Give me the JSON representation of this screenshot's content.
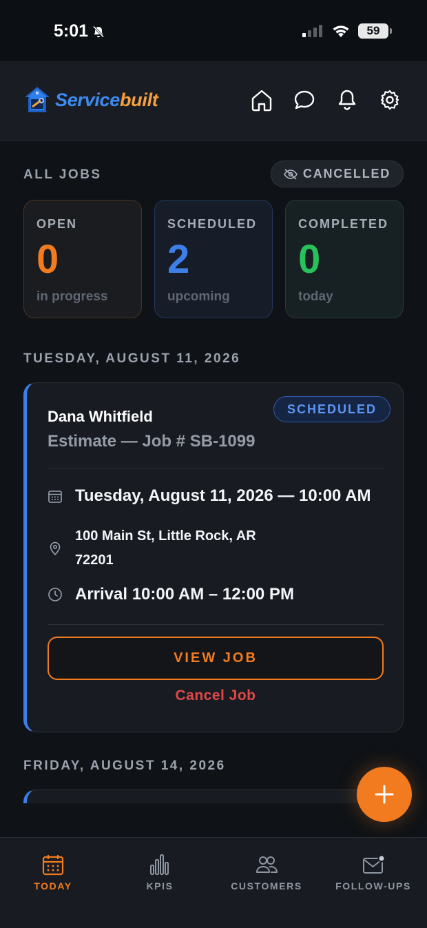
{
  "status_bar": {
    "time": "5:01",
    "battery": "59"
  },
  "header": {
    "brand_part1": "Service",
    "brand_part2": "built",
    "icons": [
      "home-icon",
      "chat-icon",
      "bell-icon",
      "gear-icon"
    ]
  },
  "summary": {
    "section_label": "ALL JOBS",
    "cancelled_toggle": "CANCELLED",
    "cards": [
      {
        "title": "OPEN",
        "value": "0",
        "subtitle": "in progress",
        "color": "#f37b1f"
      },
      {
        "title": "SCHEDULED",
        "value": "2",
        "subtitle": "upcoming",
        "color": "#3d7ee8"
      },
      {
        "title": "COMPLETED",
        "value": "0",
        "subtitle": "today",
        "color": "#27c25a"
      }
    ]
  },
  "day_groups": [
    {
      "date_label": "TUESDAY, AUGUST 11, 2026",
      "job": {
        "status": "SCHEDULED",
        "customer": "Dana Whitfield",
        "subtitle": "Estimate — Job # SB-1099",
        "date_time": "Tuesday, August 11, 2026 — 10:00 AM",
        "address_line1": "100 Main St, Little Rock, AR",
        "address_line2": "72201",
        "arrival": "Arrival 10:00 AM – 12:00 PM",
        "view_button": "VIEW JOB",
        "cancel_link": "Cancel Job"
      }
    },
    {
      "date_label": "FRIDAY, AUGUST 14, 2026"
    }
  ],
  "bottom_nav": [
    {
      "label": "TODAY",
      "icon": "calendar-icon",
      "active": true
    },
    {
      "label": "KPIS",
      "icon": "bar-chart-icon",
      "active": false
    },
    {
      "label": "CUSTOMERS",
      "icon": "users-icon",
      "active": false
    },
    {
      "label": "FOLLOW-UPS",
      "icon": "mail-icon",
      "active": false
    }
  ],
  "colors": {
    "accent": "#f37b1f",
    "scheduled": "#3d7ee8",
    "completed": "#27c25a",
    "danger": "#e04848"
  }
}
